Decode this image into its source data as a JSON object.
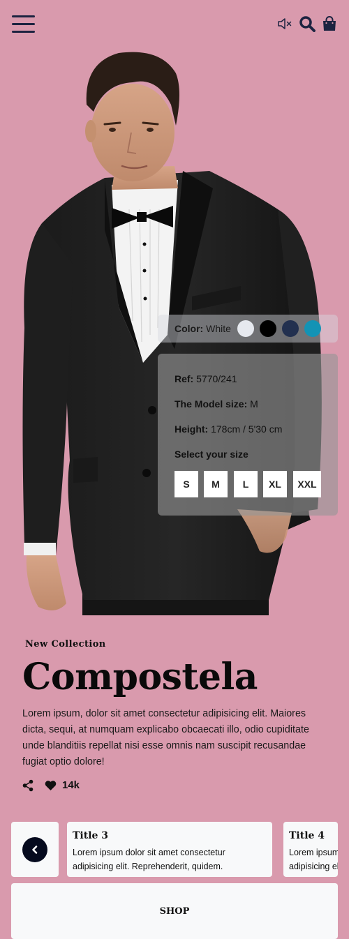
{
  "header": {
    "icons": [
      "hamburger-menu-icon",
      "speaker-icon",
      "search-icon",
      "shopping-bag-icon"
    ],
    "icon_color": "#1c2340"
  },
  "colors": {
    "label": "Color:",
    "value": "White",
    "swatches": [
      {
        "name": "white",
        "hex": "#e6e9ef"
      },
      {
        "name": "black",
        "hex": "#000000"
      },
      {
        "name": "navy",
        "hex": "#22304f"
      },
      {
        "name": "teal",
        "hex": "#1393b5"
      }
    ]
  },
  "details": {
    "ref_label": "Ref:",
    "ref_value": "5770/241",
    "model_size_label": "The Model size:",
    "model_size_value": "M",
    "height_label": "Height:",
    "height_value": "178cm / 5'30 cm",
    "select_size_label": "Select your size",
    "sizes": [
      "S",
      "M",
      "L",
      "XL",
      "XXL"
    ]
  },
  "product": {
    "kicker": "New Collection",
    "title": "Compostela",
    "description": "Lorem ipsum, dolor sit amet consectetur adipisicing elit. Maiores dicta, sequi, at numquam explicabo obcaecati illo, odio cupiditate unde blanditiis repellat nisi esse omnis nam suscipit recusandae fugiat optio dolore!",
    "likes": "14k"
  },
  "cards": [
    {
      "title": "Title 3",
      "text": "Lorem ipsum dolor sit amet consectetur adipisicing elit. Reprehenderit, quidem."
    },
    {
      "title": "Title 4",
      "text": "Lorem ipsum dolor sit amet consectetur adipisicing elit. Reprehenderit, quidem."
    }
  ],
  "shop_label": "SHOP",
  "theme": {
    "background": "#d99aad",
    "card": "#f8f9fa",
    "dark_button": "#050a1e"
  }
}
